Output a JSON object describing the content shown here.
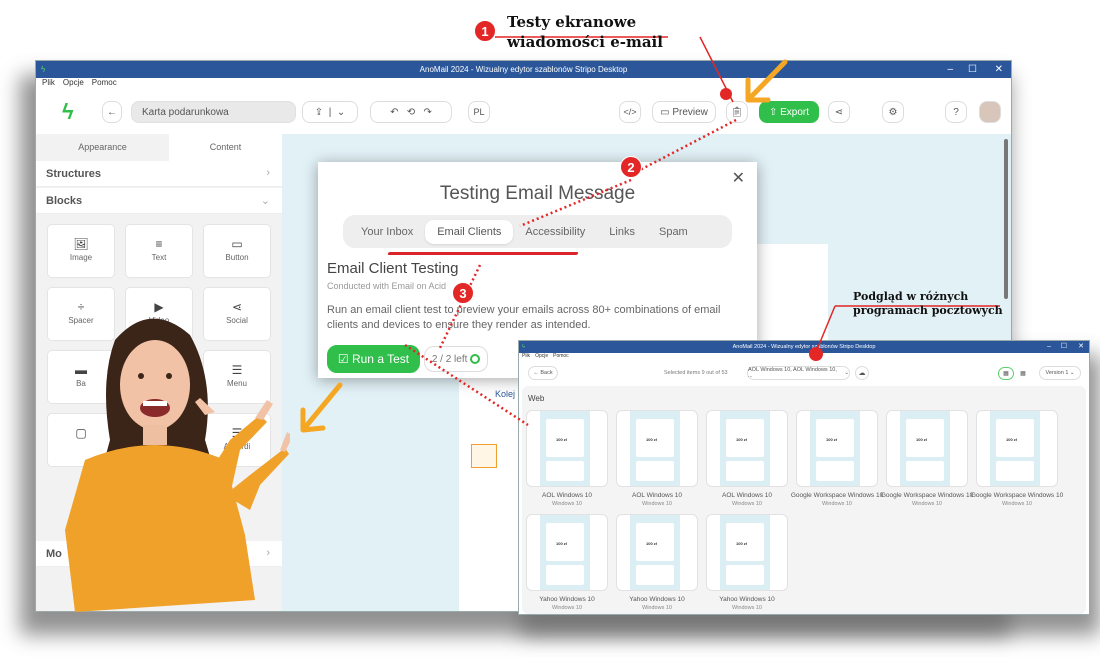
{
  "annotations": {
    "step1": "1",
    "step1_text_line1": "Testy ekranowe",
    "step1_text_line2": "wiadomości e-mail",
    "step2": "2",
    "step3": "3",
    "preview_text_line1": "Podgląd w różnych",
    "preview_text_line2": "programach pocztowych",
    "accent": "#e32626",
    "arrow_color": "#f5a623"
  },
  "main_window": {
    "title": "AnoMail 2024 - Wizualny edytor szablonów Stripo Desktop",
    "menu": [
      "Plik",
      "Opcje",
      "Pomoc"
    ],
    "toolbar": {
      "template_name": "Karta podarunkowa",
      "language": "PL",
      "preview_label": "Preview",
      "export_label": "Export",
      "export_color": "#2fbf4a"
    },
    "panel_tabs": [
      "Appearance",
      "Content"
    ],
    "active_panel_tab": "Content",
    "sections": {
      "structures": "Structures",
      "blocks": "Blocks",
      "modules": "Mo"
    },
    "blocks": [
      {
        "label": "Image",
        "icon": "image-icon"
      },
      {
        "label": "Text",
        "icon": "text-icon"
      },
      {
        "label": "Button",
        "icon": "button-icon"
      },
      {
        "label": "Spacer",
        "icon": "spacer-icon"
      },
      {
        "label": "Video",
        "icon": "video-icon"
      },
      {
        "label": "Social",
        "icon": "share-icon"
      },
      {
        "label": "Ba",
        "icon": "banner-icon"
      },
      {
        "label": "r",
        "icon": "timer-icon"
      },
      {
        "label": "Menu",
        "icon": "menu-icon"
      },
      {
        "label": "",
        "icon": "block-icon"
      },
      {
        "label": "",
        "icon": "block-icon"
      },
      {
        "label": "Accordi",
        "icon": "accordion-icon"
      }
    ],
    "canvas_text": "Kolej"
  },
  "modal": {
    "title": "Testing Email Message",
    "tabs": [
      "Your Inbox",
      "Email Clients",
      "Accessibility",
      "Links",
      "Spam"
    ],
    "active_tab": "Email Clients",
    "heading": "Email Client Testing",
    "subheading": "Conducted with Email on Acid",
    "description": "Run an email client test to preview your emails across 80+ combinations of email clients and devices to ensure they render as intended.",
    "run_button": "Run a Test",
    "remaining": "2 / 2 left"
  },
  "preview_window": {
    "title": "AnoMail 2024 - Wizualny edytor szablonów Stripo Desktop",
    "menu": [
      "Plik",
      "Opcje",
      "Pomoc"
    ],
    "back_label": "Back",
    "selected_info": "Selected items 9 out of 53",
    "client_select": "AOL Windows 10, AOL Windows 10, ...",
    "version_select": "Version 1",
    "section": "Web",
    "cards": [
      {
        "name": "AOL Windows 10",
        "os": "Windows 10"
      },
      {
        "name": "AOL Windows 10",
        "os": "Windows 10"
      },
      {
        "name": "AOL Windows 10",
        "os": "Windows 10"
      },
      {
        "name": "Google Workspace Windows 10",
        "os": "Windows 10"
      },
      {
        "name": "Google Workspace Windows 10",
        "os": "Windows 10"
      },
      {
        "name": "Google Workspace Windows 10",
        "os": "Windows 10"
      },
      {
        "name": "Yahoo Windows 10",
        "os": "Windows 10"
      },
      {
        "name": "Yahoo Windows 10",
        "os": "Windows 10"
      },
      {
        "name": "Yahoo Windows 10",
        "os": "Windows 10"
      }
    ],
    "card_amount": "100 zł"
  }
}
